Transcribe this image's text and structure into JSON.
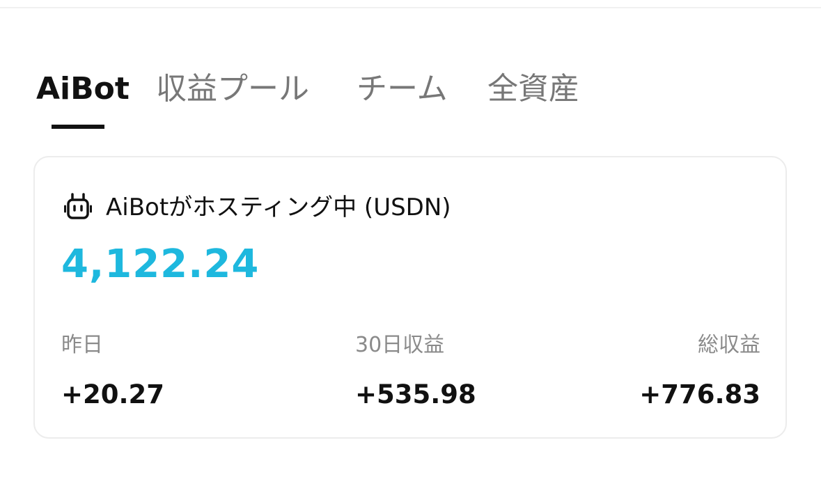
{
  "tabs": [
    {
      "label": "AiBot",
      "active": true
    },
    {
      "label": "収益プール",
      "active": false
    },
    {
      "label": "チーム",
      "active": false
    },
    {
      "label": "全資産",
      "active": false
    }
  ],
  "card": {
    "icon": "robot-icon",
    "title": "AiBotがホスティング中 (USDN)",
    "balance": "4,122.24",
    "stats": [
      {
        "label": "昨日",
        "value": "+20.27"
      },
      {
        "label": "30日収益",
        "value": "+535.98"
      },
      {
        "label": "総収益",
        "value": "+776.83"
      }
    ]
  },
  "colors": {
    "accent": "#1eb8de",
    "text_primary": "#111111",
    "text_secondary": "#8a8a8a",
    "tab_inactive": "#777777",
    "card_border": "#ececec"
  }
}
